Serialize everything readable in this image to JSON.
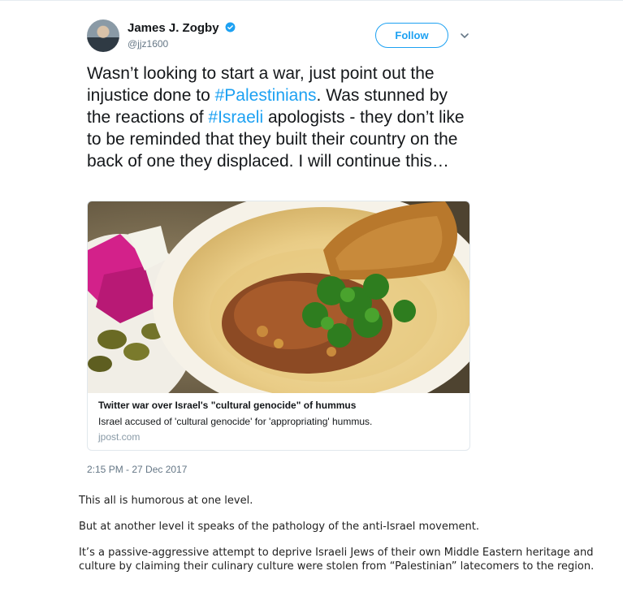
{
  "tweet": {
    "author_name": "James J. Zogby",
    "handle": "@jjz1600",
    "follow_label": "Follow",
    "text_parts": {
      "p1": "Wasn’t looking to start a war, just point out the injustice done to ",
      "h1": "#Palestinians",
      "p2": ". Was stunned by the reactions of ",
      "h2": "#Israeli",
      "p3": " apologists - they don’t like to be reminded that they built their country on the back of one they displaced. I will continue this…"
    },
    "card": {
      "title": "Twitter war over Israel's \"cultural genocide\" of hummus",
      "description": "Israel accused of 'cultural genocide' for 'appropriating' hummus.",
      "domain": "jpost.com"
    },
    "timestamp": "2:15 PM - 27 Dec 2017",
    "colors": {
      "link": "#1da1f2",
      "muted": "#657786"
    }
  },
  "article": {
    "paragraphs": [
      "This all is humorous at one level.",
      "But at another level it speaks of the pathology of the anti-Israel movement.",
      "It’s a passive-aggressive attempt to deprive Israeli Jews of their own Middle Eastern heritage and culture by claiming their culinary culture were stolen from “Palestinian” latecomers to the region."
    ]
  }
}
